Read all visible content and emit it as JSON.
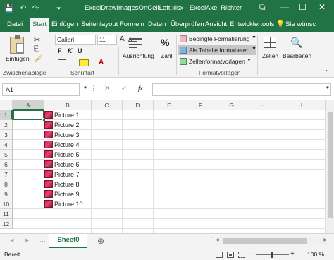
{
  "titlebar": {
    "title": "ExcelDrawImagesOnCellLeft.xlsx - Excel",
    "user": "Axel Richter",
    "save_icon": "💾",
    "undo_icon": "↶",
    "redo_icon": "↷",
    "customize_icon": "⏷",
    "restore_icon": "⧉",
    "minimize_icon": "—",
    "maximize_icon": "☐",
    "close_icon": "✕"
  },
  "tabs": [
    "Datei",
    "Start",
    "Einfügen",
    "Seitenlayout",
    "Formeln",
    "Daten",
    "Überprüfen",
    "Ansicht",
    "Entwicklertools"
  ],
  "tell_me": "Sie wünsc",
  "ribbon": {
    "paste_label": "Einfügen",
    "clipboard_group": "Zwischenablage",
    "font_name": "Calibri",
    "font_size": "11",
    "font_group": "Schriftart",
    "align_label": "Ausrichtung",
    "number_label": "Zahl",
    "cond_format": "Bedingte Formatierung",
    "as_table": "Als Tabelle formatieren",
    "cell_styles": "Zellenformatvorlagen",
    "styles_group": "Formatvorlagen",
    "cells_label": "Zellen",
    "edit_label": "Bearbeiten",
    "bold": "F",
    "italic": "K",
    "underline": "U",
    "grow_font": "A",
    "shrink_font": "A"
  },
  "formula_bar": {
    "name_box": "A1",
    "cancel": "✕",
    "confirm": "✓",
    "fx": "fx",
    "value": ""
  },
  "grid": {
    "columns": [
      "A",
      "B",
      "C",
      "D",
      "E",
      "F",
      "G",
      "H",
      "I"
    ],
    "rows": [
      "1",
      "2",
      "3",
      "4",
      "5",
      "6",
      "7",
      "8",
      "9",
      "10",
      "11",
      "12"
    ],
    "pictures": [
      "Picture 1",
      "Picture 2",
      "Picture 3",
      "Picture 4",
      "Picture 5",
      "Picture 6",
      "Picture 7",
      "Picture 8",
      "Picture 9",
      "Picture 10"
    ]
  },
  "sheetbar": {
    "active_sheet": "Sheet0",
    "add_sheet": "⊕",
    "prev": "◀",
    "next": "▶"
  },
  "statusbar": {
    "ready": "Bereit",
    "zoom": "100 %",
    "minus": "–",
    "plus": "+"
  }
}
